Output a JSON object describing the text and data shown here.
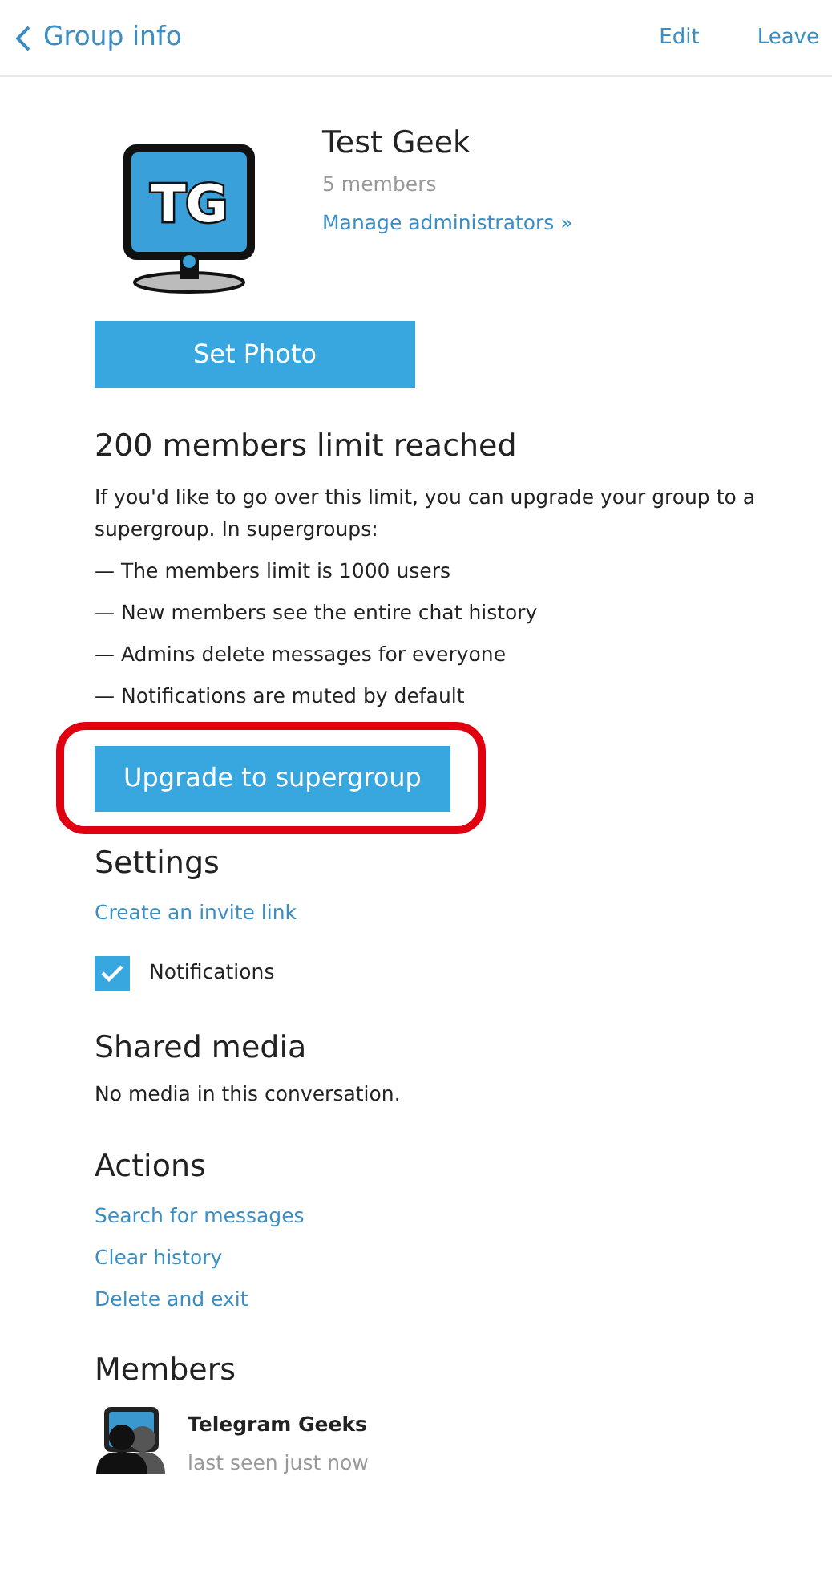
{
  "header": {
    "back_label": "Group info",
    "actions": [
      "Edit",
      "Leave"
    ]
  },
  "group": {
    "logo_text": "TG",
    "name": "Test Geek",
    "members_count": "5 members",
    "manage_link": "Manage administrators »"
  },
  "set_photo_button": "Set Photo",
  "limit": {
    "title": "200 members limit reached",
    "intro": "If you'd like to go over this limit, you can upgrade your group to a supergroup. In supergroups:",
    "points": [
      "— The members limit is 1000 users",
      "— New members see the entire chat history",
      "— Admins delete messages for everyone",
      "— Notifications are muted by default"
    ],
    "upgrade_button": "Upgrade to supergroup",
    "highlighted": true
  },
  "settings": {
    "title": "Settings",
    "invite_link": "Create an invite link",
    "notifications": {
      "label": "Notifications",
      "checked": true
    }
  },
  "shared_media": {
    "title": "Shared media",
    "text": "No media in this conversation."
  },
  "actions": {
    "title": "Actions",
    "links": [
      "Search for messages",
      "Clear history",
      "Delete and exit"
    ]
  },
  "members": {
    "title": "Members",
    "items": [
      {
        "name": "Telegram Geeks",
        "status": "last seen just now"
      }
    ]
  }
}
